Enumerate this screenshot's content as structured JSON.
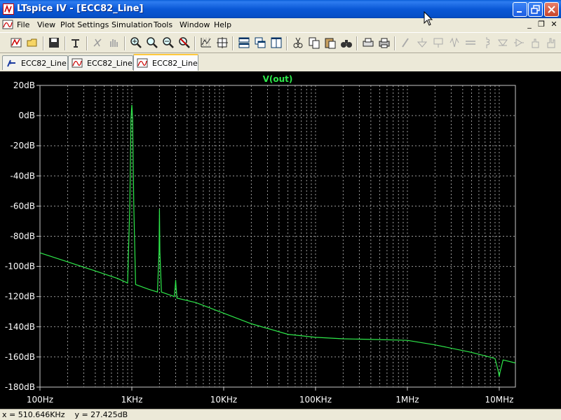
{
  "window": {
    "title": "LTspice IV - [ECC82_Line]",
    "minimize_icon": "minimize-icon",
    "maximize_icon": "restore-icon",
    "close_icon": "close-icon"
  },
  "menu": {
    "items": [
      "File",
      "View",
      "Plot Settings",
      "Simulation",
      "Tools",
      "Window",
      "Help"
    ],
    "mdi_controls": [
      "_",
      "❐",
      "✕"
    ]
  },
  "toolbar": {
    "icons": [
      "run-icon",
      "open-icon",
      "save-icon",
      "control-panel-icon",
      "halt-icon",
      "pan-icon",
      "zoom-in-icon",
      "zoom-out-area-icon",
      "zoom-out-icon",
      "zoom-cancel-icon",
      "autorange-icon",
      "fit-icon",
      "tile-horizontal-icon",
      "cascade-icon",
      "tile-icon",
      "cut-icon",
      "copy-icon",
      "paste-icon",
      "find-icon",
      "print-preview-icon",
      "print-icon",
      "wire-icon",
      "ground-icon",
      "label-icon",
      "resistor-icon",
      "capacitor-icon",
      "inductor-icon",
      "diode-icon",
      "component-icon",
      "move-icon",
      "drag-icon"
    ]
  },
  "tabs": [
    {
      "label": "ECC82_Line",
      "icon": "schematic-icon",
      "active": false
    },
    {
      "label": "ECC82_Line",
      "icon": "waveform-icon",
      "active": false
    },
    {
      "label": "ECC82_Line",
      "icon": "waveform-icon",
      "active": true
    }
  ],
  "plot": {
    "trace_label": "V(out)",
    "trace_color": "#2ee84a",
    "background": "#000000",
    "grid_color": "#9a9a9a"
  },
  "chart_data": {
    "type": "line",
    "title": "V(out)",
    "x_scale": "log",
    "xlabel": "",
    "ylabel": "",
    "xlim": [
      100,
      15000000
    ],
    "ylim": [
      -180,
      20
    ],
    "x_ticks": [
      "100Hz",
      "1KHz",
      "10KHz",
      "100KHz",
      "1MHz",
      "10MHz"
    ],
    "x_tick_values": [
      100,
      1000,
      10000,
      100000,
      1000000,
      10000000
    ],
    "y_ticks": [
      "20dB",
      "0dB",
      "-20dB",
      "-40dB",
      "-60dB",
      "-80dB",
      "-100dB",
      "-120dB",
      "-140dB",
      "-160dB",
      "-180dB"
    ],
    "y_tick_values": [
      20,
      0,
      -20,
      -40,
      -60,
      -80,
      -100,
      -120,
      -140,
      -160,
      -180
    ],
    "grid": true,
    "series": [
      {
        "name": "V(out)",
        "x": [
          100,
          200,
          400,
          700,
          900,
          950,
          980,
          1000,
          1020,
          1050,
          1100,
          1500,
          1900,
          1980,
          2000,
          2020,
          2100,
          2900,
          2980,
          3000,
          3020,
          3100,
          5000,
          10000,
          20000,
          50000,
          100000,
          200000,
          500000,
          1000000,
          2000000,
          5000000,
          9000000,
          9800000,
          10000000,
          10200000,
          11000000,
          15000000
        ],
        "y": [
          -91,
          -97,
          -103,
          -108,
          -111,
          -60,
          -2,
          7,
          -2,
          -60,
          -112,
          -115,
          -117,
          -90,
          -62,
          -90,
          -117,
          -120,
          -112,
          -109,
          -112,
          -121,
          -124,
          -131,
          -138,
          -145,
          -147,
          -148,
          -148.5,
          -149,
          -152,
          -157,
          -161,
          -170,
          -173,
          -170,
          -162,
          -164
        ]
      }
    ]
  },
  "status": {
    "text": "x = 510.646KHz    y = 27.425dB"
  }
}
